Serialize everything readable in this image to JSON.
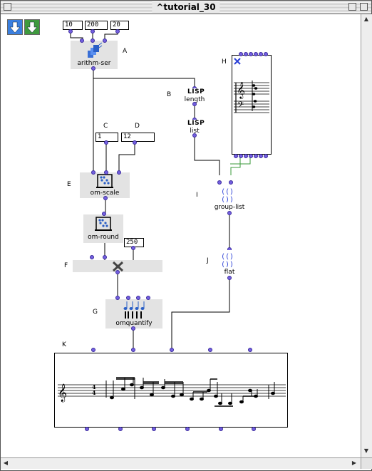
{
  "window": {
    "title": "^tutorial_30"
  },
  "nav": {
    "back_icon": "blue-down-arrow-icon",
    "forward_icon": "green-down-arrow-icon"
  },
  "boxes": {
    "arithm_ser": {
      "label": "arithm-ser",
      "letter": "A",
      "inputs": [
        "10",
        "200",
        "20"
      ]
    },
    "length": {
      "label": "length",
      "letter": "B",
      "glyph": "LISP"
    },
    "list": {
      "label": "list",
      "glyph": "LISP"
    },
    "scale_min": {
      "value": "1",
      "letter": "C"
    },
    "scale_max": {
      "value": "12",
      "letter": "D"
    },
    "om_scale": {
      "label": "om-scale",
      "letter": "E"
    },
    "om_round": {
      "label": "om-round"
    },
    "times": {
      "letter": "F",
      "input": "250"
    },
    "omquantify": {
      "label": "omquantify",
      "letter": "G"
    },
    "chord_editor": {
      "letter": "H"
    },
    "group_list": {
      "label": "group-list",
      "letter": "I"
    },
    "flat": {
      "label": "flat",
      "letter": "J"
    },
    "voice": {
      "letter": "K"
    }
  },
  "colors": {
    "outlet": "#7460e0",
    "connection": "#000000",
    "highlight_connection": "#3a9a3a"
  }
}
